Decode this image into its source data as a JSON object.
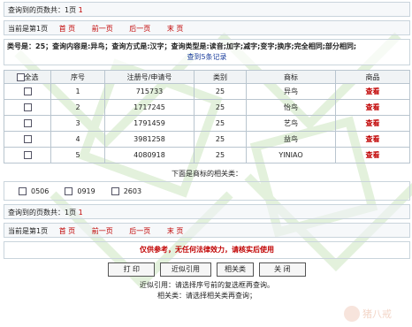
{
  "pager_top": {
    "pages_found_label": "查询到的页数共：",
    "pages_found_value": "1页",
    "pages_found_extra": "1",
    "current_label": "当前是第1页",
    "nav": [
      "首 页",
      "前一页",
      "后一页",
      "末 页"
    ]
  },
  "summary": {
    "text": "类号是：25；查询内容是:异鸟；查询方式是:汉字；查询类型是:读音;加字;减字;变字;换序;完全相同;部分相同;",
    "count": "查到5条记录"
  },
  "table": {
    "select_all": "全选",
    "headers": [
      "序号",
      "注册号/申请号",
      "类别",
      "商标",
      "商品"
    ],
    "rows": [
      {
        "no": "1",
        "reg": "715733",
        "class": "25",
        "mark": "异鸟",
        "action": "查看"
      },
      {
        "no": "2",
        "reg": "1717245",
        "class": "25",
        "mark": "怡鸟",
        "action": "查看"
      },
      {
        "no": "3",
        "reg": "1791459",
        "class": "25",
        "mark": "艺鸟",
        "action": "查看"
      },
      {
        "no": "4",
        "reg": "3981258",
        "class": "25",
        "mark": "益鸟",
        "action": "查看"
      },
      {
        "no": "5",
        "reg": "4080918",
        "class": "25",
        "mark": "YINIAO",
        "action": "查看"
      }
    ]
  },
  "related": {
    "title": "下面是商标的相关类：",
    "classes": [
      "0506",
      "0919",
      "2603"
    ]
  },
  "pager_bottom": {
    "pages_found_label": "查询到的页数共：",
    "pages_found_value": "1页",
    "pages_found_extra": "1",
    "current_label": "当前是第1页",
    "nav": [
      "首 页",
      "前一页",
      "后一页",
      "末 页"
    ]
  },
  "notice": "仅供参考，无任何法律效力，请核实后使用",
  "buttons": [
    "打 印",
    "近似引用",
    "相关类",
    "关 闭"
  ],
  "help": {
    "line1": "近似引用：请选择序号前的复选框再查询。",
    "line2": "相关类：请选择相关类再查询；"
  },
  "colors": {
    "link_red": "#c00000",
    "count_blue": "#1a3d9c",
    "border": "#c9d4dc",
    "watermark_green": "#d8ecd0"
  }
}
